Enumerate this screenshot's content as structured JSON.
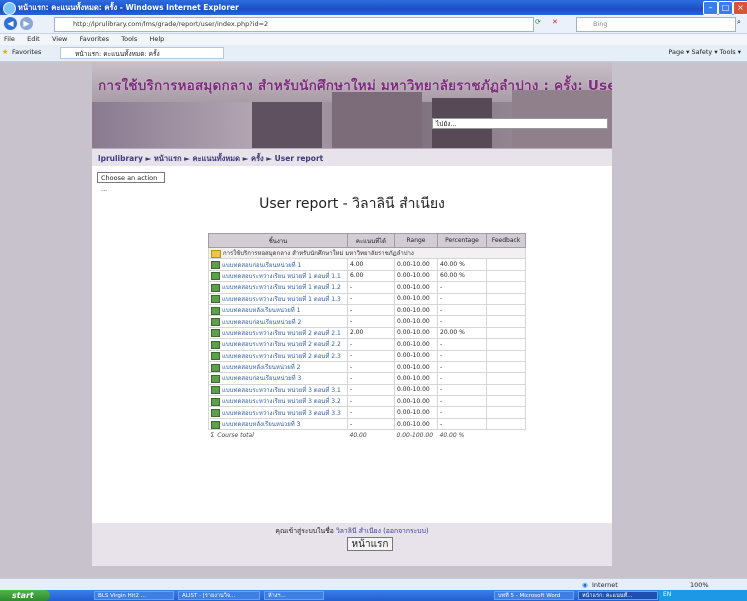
{
  "window": {
    "title": "หน้าแรก: คะแนนทั้งหมด: ครั้ง - Windows Internet Explorer"
  },
  "address": {
    "url": "http://lprulibrary.com/lms/grade/report/user/index.php?id=2",
    "search_placeholder": "Bing"
  },
  "menu": [
    "File",
    "Edit",
    "View",
    "Favorites",
    "Tools",
    "Help"
  ],
  "favorites": {
    "label": "Favorites",
    "tab": "หน้าแรก: คะแนนทั้งหมด: ครั้ง",
    "tools": "Page ▾  Safety ▾  Tools ▾"
  },
  "site": {
    "title": "การใช้บริการหอสมุดกลาง สำหรับนักศึกษาใหม่ มหาวิทยาลัยราชภัฏลำปาง : ครั้ง: User report",
    "jump_select": "ไปยัง..."
  },
  "breadcrumb": "lprulibrary ► หน้าแรก ► คะแนนทั้งหมด ► ครั้ง ► User report",
  "action_select": "Choose an action ...",
  "page_heading": "User report - วิลาลินี สำเนียง",
  "table": {
    "headers": [
      "ชิ้นงาน",
      "คะแนนที่ได้",
      "Range",
      "Percentage",
      "Feedback"
    ],
    "category": "การใช้บริการหอสมุดกลาง สำหรับนักศึกษาใหม่ มหาวิทยาลัยราชภัฏลำปาง",
    "rows": [
      {
        "item": "แบบทดสอบก่อนเรียนหน่วยที่ 1",
        "grade": "4.00",
        "range": "0.00-10.00",
        "pct": "40.00 %"
      },
      {
        "item": "แบบทดสอบระหว่างเรียน หน่วยที่ 1 ตอนที่ 1.1",
        "grade": "6.00",
        "range": "0.00-10.00",
        "pct": "60.00 %"
      },
      {
        "item": "แบบทดสอบระหว่างเรียน หน่วยที่ 1 ตอนที่ 1.2",
        "grade": "-",
        "range": "0.00-10.00",
        "pct": "-"
      },
      {
        "item": "แบบทดสอบระหว่างเรียน หน่วยที่ 1 ตอนที่ 1.3",
        "grade": "-",
        "range": "0.00-10.00",
        "pct": "-"
      },
      {
        "item": "แบบทดสอบหลังเรียนหน่วยที่ 1",
        "grade": "-",
        "range": "0.00-10.00",
        "pct": "-"
      },
      {
        "item": "แบบทดสอบก่อนเรียนหน่วยที่ 2",
        "grade": "-",
        "range": "0.00-10.00",
        "pct": "-"
      },
      {
        "item": "แบบทดสอบระหว่างเรียน หน่วยที่ 2 ตอนที่ 2.1",
        "grade": "2.00",
        "range": "0.00-10.00",
        "pct": "20.00 %"
      },
      {
        "item": "แบบทดสอบระหว่างเรียน หน่วยที่ 2 ตอนที่ 2.2",
        "grade": "-",
        "range": "0.00-10.00",
        "pct": "-"
      },
      {
        "item": "แบบทดสอบระหว่างเรียน หน่วยที่ 2 ตอนที่ 2.3",
        "grade": "-",
        "range": "0.00-10.00",
        "pct": "-"
      },
      {
        "item": "แบบทดสอบหลังเรียนหน่วยที่ 2",
        "grade": "-",
        "range": "0.00-10.00",
        "pct": "-"
      },
      {
        "item": "แบบทดสอบก่อนเรียนหน่วยที่ 3",
        "grade": "-",
        "range": "0.00-10.00",
        "pct": "-"
      },
      {
        "item": "แบบทดสอบระหว่างเรียน หน่วยที่ 3 ตอนที่ 3.1",
        "grade": "-",
        "range": "0.00-10.00",
        "pct": "-"
      },
      {
        "item": "แบบทดสอบระหว่างเรียน หน่วยที่ 3 ตอนที่ 3.2",
        "grade": "-",
        "range": "0.00-10.00",
        "pct": "-"
      },
      {
        "item": "แบบทดสอบระหว่างเรียน หน่วยที่ 3 ตอนที่ 3.3",
        "grade": "-",
        "range": "0.00-10.00",
        "pct": "-"
      },
      {
        "item": "แบบทดสอบหลังเรียนหน่วยที่ 3",
        "grade": "-",
        "range": "0.00-10.00",
        "pct": "-"
      }
    ],
    "total": {
      "item": "Course total",
      "grade": "40.00",
      "range": "0.00-100.00",
      "pct": "40.00 %"
    }
  },
  "login": {
    "prefix": "คุณเข้าสู่ระบบในชื่อ ",
    "user": "วิลาลินี สำเนียง",
    "logout": "(ออกจากระบบ)"
  },
  "home_button": "หน้าแรก",
  "status": {
    "zone": "Internet",
    "zoom": "100%"
  },
  "taskbar": {
    "start": "start",
    "tasks": [
      "BLS Virgin Hit2 ...",
      "ALIST - [รายงานวิจ...",
      "ห้างฯ...",
      "บทที่ 5 - Microsoft Word",
      "หน้าแรก: คะแนนทั้...",
      "EN"
    ]
  },
  "colors": {
    "banner_title": "#7b2c7a",
    "link": "#2f5ea5",
    "page_bg": "#c8c2cc"
  }
}
